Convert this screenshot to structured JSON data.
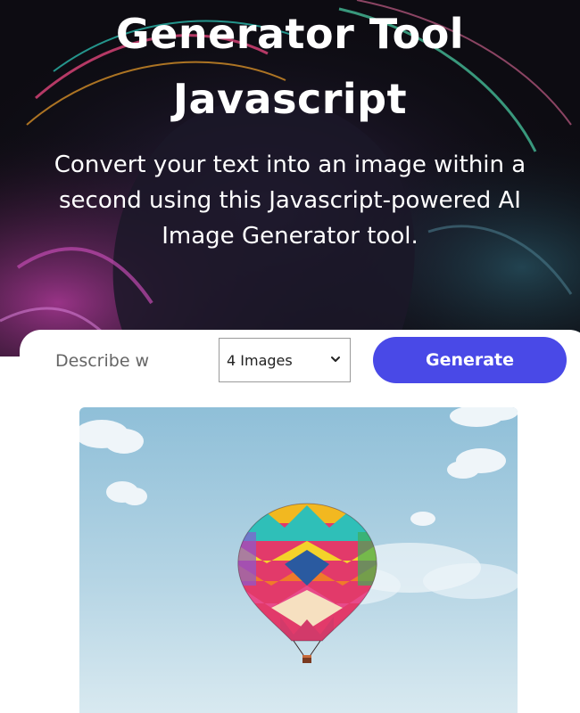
{
  "hero": {
    "title_line1": "Generator Tool",
    "title_line2": "Javascript",
    "subtitle": "Convert your text into an image within a second using this Javascript-powered AI Image Generator tool."
  },
  "form": {
    "prompt_placeholder": "Describe what you want to see",
    "prompt_visible_placeholder": "Describe w",
    "image_count_selected": "4 Images",
    "generate_label": "Generate"
  },
  "result": {
    "image_subject": "hot-air-balloon"
  },
  "colors": {
    "accent": "#4949e7",
    "hero_bg": "#0d0c12",
    "sky": "#bcd9e8"
  }
}
